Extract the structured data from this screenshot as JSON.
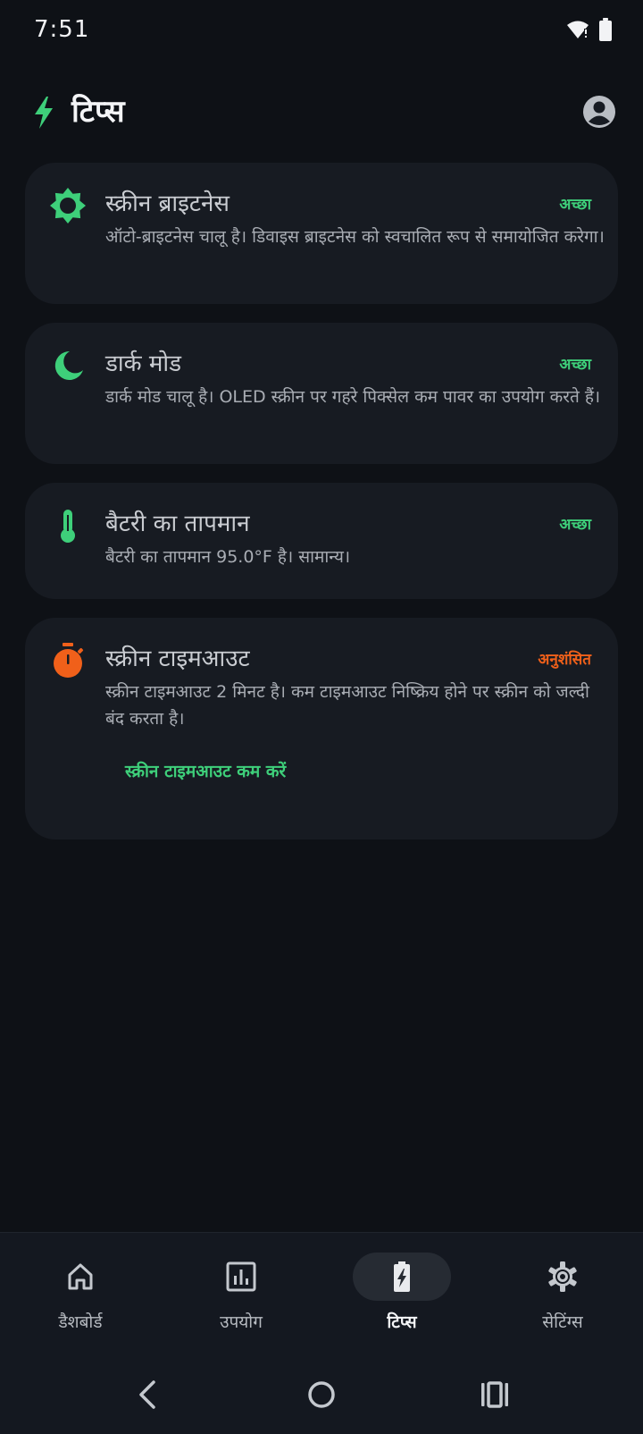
{
  "status_bar": {
    "time": "7:51",
    "icons": [
      "wifi-icon",
      "battery-icon"
    ]
  },
  "header": {
    "title": "टिप्स",
    "icon": "bolt-icon",
    "profile_icon": "account-circle-icon"
  },
  "colors": {
    "background": "#0e1116",
    "card": "#171b22",
    "good": "#3ecf7a",
    "warning": "#f0601a"
  },
  "tips": [
    {
      "icon": "brightness-icon",
      "title": "स्क्रीन ब्राइटनेस",
      "badge": "अच्छा",
      "description": "ऑटो-ब्राइटनेस चालू है। डिवाइस ब्राइटनेस को स्वचालित रूप से समायोजित करेगा।"
    },
    {
      "icon": "moon-icon",
      "title": "डार्क मोड",
      "badge": "अच्छा",
      "description": "डार्क मोड चालू है। OLED स्क्रीन पर गहरे पिक्सेल कम पावर का उपयोग करते हैं।"
    },
    {
      "icon": "thermometer-icon",
      "title": "बैटरी का तापमान",
      "badge": "अच्छा",
      "description": "बैटरी का तापमान 95.0°F है। सामान्य।"
    },
    {
      "icon": "timer-icon",
      "title": "स्क्रीन टाइमआउट",
      "badge": "अनुशंसित",
      "description": "स्क्रीन टाइमआउट 2 मिनट है। कम टाइमआउट निष्क्रिय होने पर स्क्रीन को जल्दी बंद करता है।",
      "action": "स्क्रीन टाइमआउट कम करें"
    }
  ],
  "bottom_nav": {
    "items": [
      {
        "label": "डैशबोर्ड",
        "icon": "home-icon",
        "active": false
      },
      {
        "label": "उपयोग",
        "icon": "bar-chart-icon",
        "active": false
      },
      {
        "label": "टिप्स",
        "icon": "battery-charging-icon",
        "active": true
      },
      {
        "label": "सेटिंग्स",
        "icon": "gear-icon",
        "active": false
      }
    ]
  },
  "system_nav": [
    "back-icon",
    "home-circle-icon",
    "recents-icon"
  ]
}
